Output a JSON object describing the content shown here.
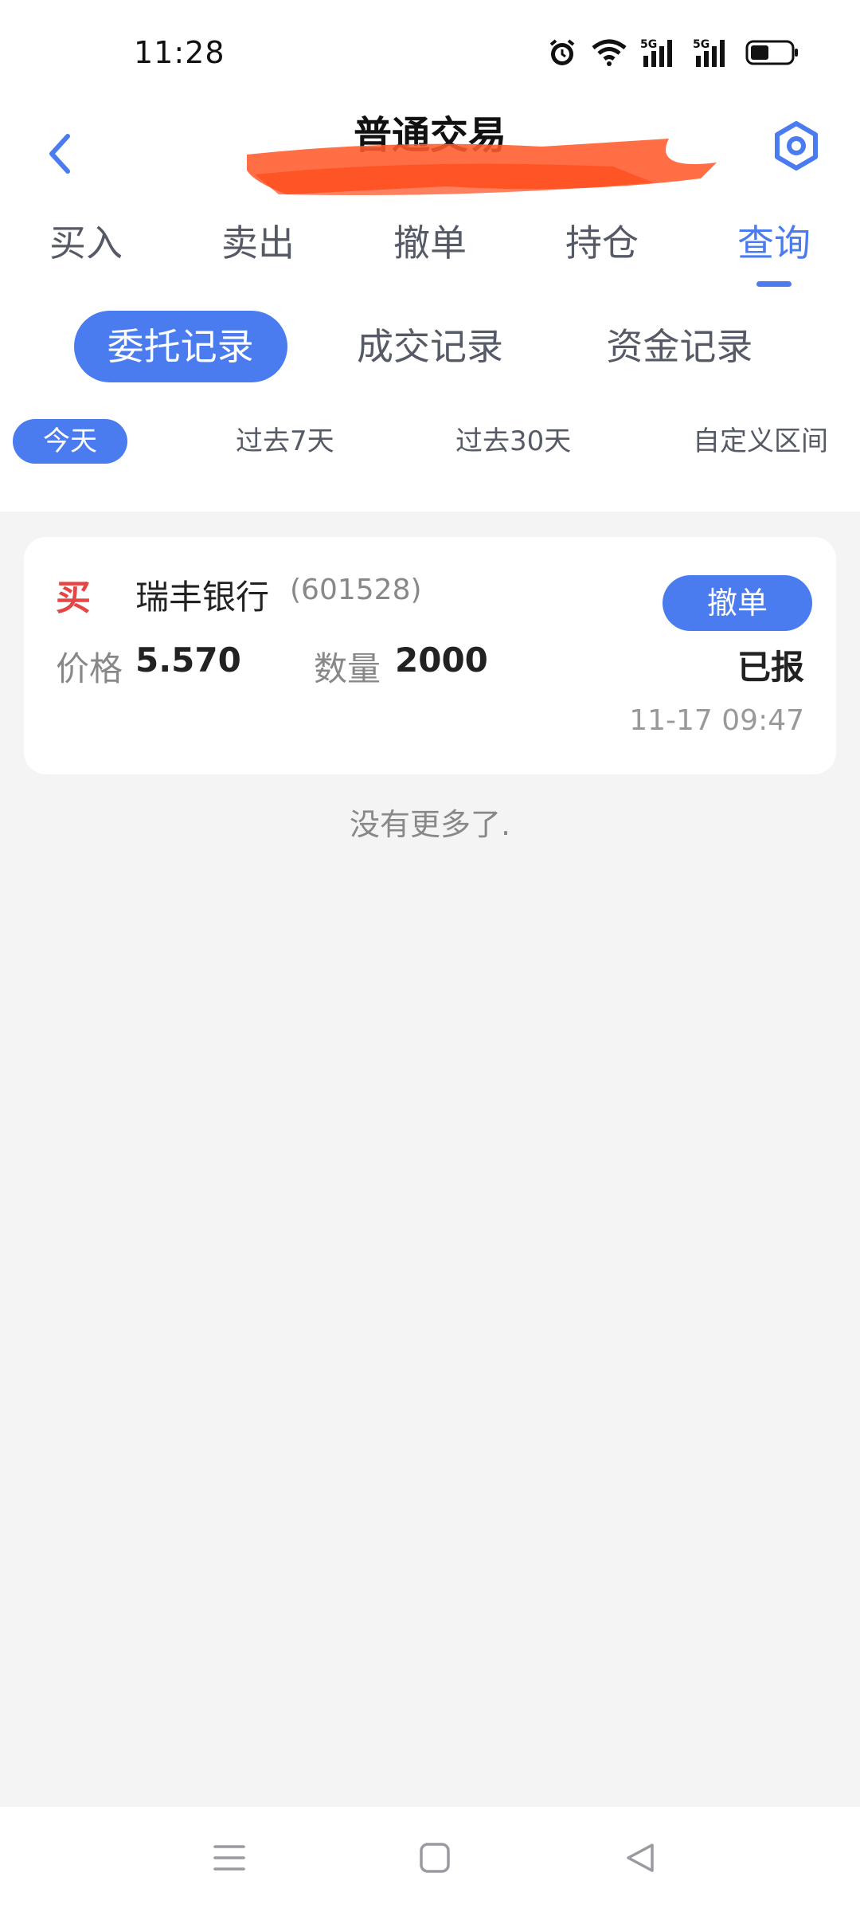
{
  "status_bar": {
    "time": "11:28",
    "icons": [
      "alarm-icon",
      "wifi-icon",
      "5g-signal-icon",
      "5g-signal-icon",
      "battery-icon"
    ]
  },
  "header": {
    "title": "普通交易",
    "back_icon": "chevron-left-icon",
    "settings_icon": "hexagon-settings-icon",
    "accent": "#4a7cf0",
    "redaction_color": "#ff5a2a"
  },
  "tabs": [
    {
      "label": "买入"
    },
    {
      "label": "卖出"
    },
    {
      "label": "撤单"
    },
    {
      "label": "持仓"
    },
    {
      "label": "查询",
      "active": true
    }
  ],
  "subtabs": [
    {
      "label": "委托记录",
      "active": true
    },
    {
      "label": "成交记录"
    },
    {
      "label": "资金记录"
    }
  ],
  "filters": [
    {
      "label": "今天",
      "active": true
    },
    {
      "label": "过去7天"
    },
    {
      "label": "过去30天"
    },
    {
      "label": "自定义区间"
    }
  ],
  "order": {
    "side": "买",
    "side_color": "#e54545",
    "name": "瑞丰银行",
    "code": "(601528)",
    "cancel_label": "撤单",
    "price_label": "价格",
    "price": "5.570",
    "qty_label": "数量",
    "qty": "2000",
    "status": "已报",
    "time": "11-17 09:47"
  },
  "footer_text": "没有更多了.",
  "nav": [
    "menu-icon",
    "home-square-icon",
    "back-triangle-icon"
  ]
}
